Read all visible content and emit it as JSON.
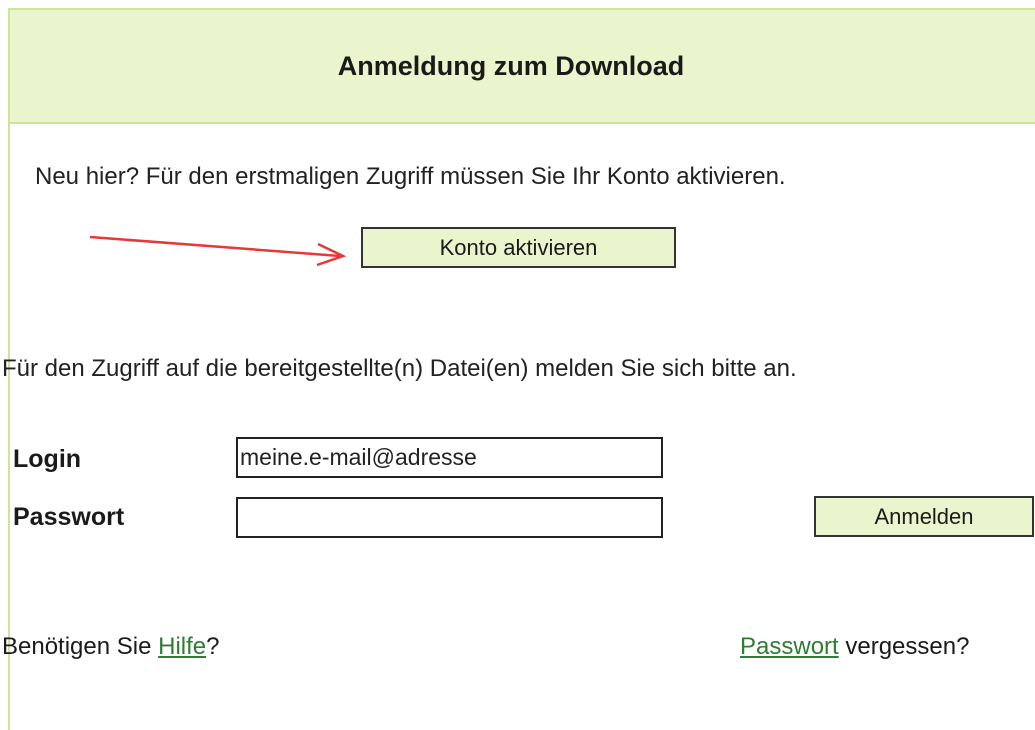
{
  "panel": {
    "title": "Anmeldung zum Download",
    "intro_text": "Neu hier? Für den erstmaligen Zugriff müssen Sie Ihr Konto aktivieren.",
    "activate_button": "Konto aktivieren",
    "access_text": "Für den Zugriff auf die bereitgestellte(n) Datei(en) melden Sie sich bitte an."
  },
  "form": {
    "login_label": "Login",
    "login_value": "meine.e-mail@adresse",
    "password_label": "Passwort",
    "password_value": "",
    "submit_button": "Anmelden"
  },
  "footer": {
    "help_prefix": "Benötigen Sie ",
    "help_link": "Hilfe",
    "help_suffix": "?",
    "forgot_link": "Passwort",
    "forgot_suffix": " vergessen?"
  },
  "annotation": {
    "arrow_color": "#e53935",
    "accent_bg": "#ebf5cd",
    "link_color": "#2e7d32"
  }
}
